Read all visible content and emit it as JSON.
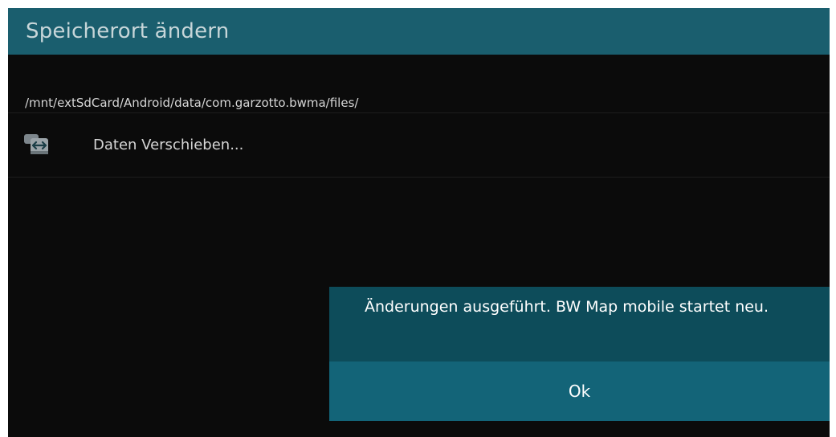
{
  "titlebar": {
    "title": "Speicherort ändern"
  },
  "storage": {
    "path": "/mnt/extSdCard/Android/data/com.garzotto.bwma/files/"
  },
  "preferences": {
    "move_data_label": "Daten Verschieben...",
    "move_data_icon": "move-data-icon"
  },
  "dialog": {
    "message": "Änderungen ausgeführt. BW Map mobile startet neu.",
    "ok_label": "Ok"
  },
  "colors": {
    "titlebar_bg": "#1a5e6e",
    "screen_bg": "#0b0b0b",
    "dialog_bg": "#0d4c5a",
    "dialog_button_bg": "#136478"
  }
}
